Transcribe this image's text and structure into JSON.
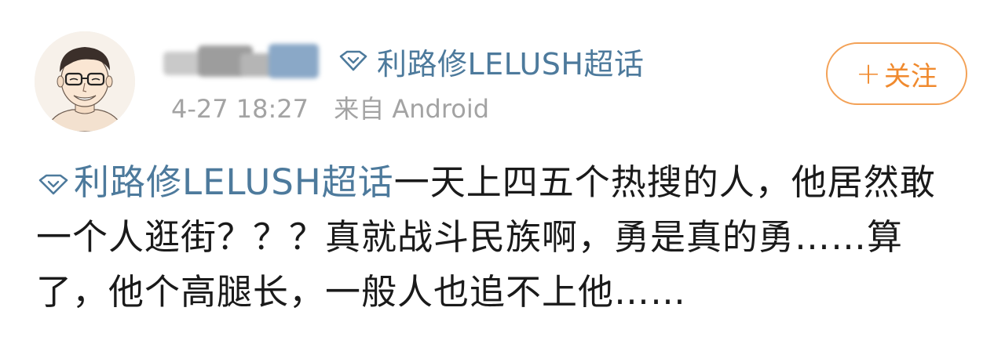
{
  "post": {
    "author": {
      "name_redacted": true
    },
    "topic_tag": "利路修LELUSH超话",
    "timestamp": "4-27 18:27",
    "source": "来自 Android",
    "follow_button": {
      "plus": "+",
      "label": "关注"
    },
    "content": {
      "tag": "利路修LELUSH超话",
      "text": "一天上四五个热搜的人，他居然敢一个人逛街？？？真就战斗民族啊，勇是真的勇……算了，他个高腿长，一般人也追不上他……"
    }
  },
  "colors": {
    "link": "#4d7a9c",
    "meta": "#a3a3a3",
    "follow_accent": "#f08a2e",
    "text": "#1a1a1a"
  }
}
